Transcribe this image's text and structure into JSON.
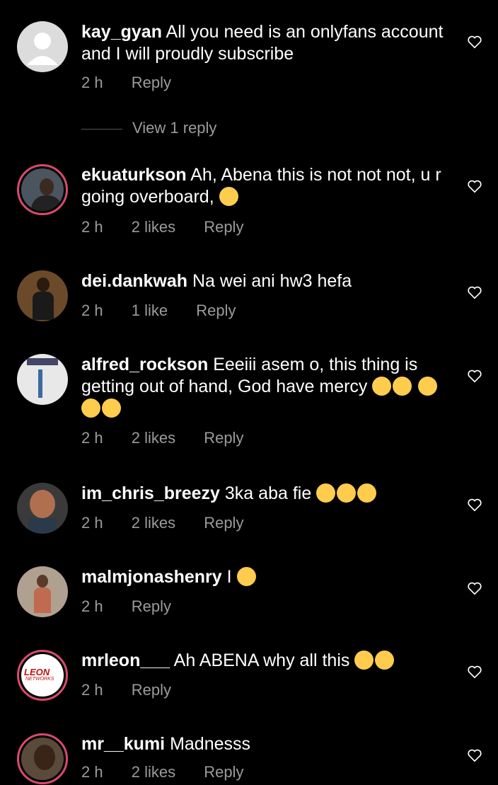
{
  "comments": [
    {
      "username": "kay_gyan",
      "text": "All you need is an onlyfans account and I will proudly subscribe",
      "time": "2 h",
      "likes": "",
      "reply": "Reply"
    },
    {
      "username": "ekuaturkson",
      "text": "Ah, Abena this is not not not, u r going overboard,",
      "time": "2 h",
      "likes": "2 likes",
      "reply": "Reply"
    },
    {
      "username": "dei.dankwah",
      "text": "Na wei ani hw3 hefa",
      "time": "2 h",
      "likes": "1 like",
      "reply": "Reply"
    },
    {
      "username": "alfred_rockson",
      "text": "Eeeiii asem o, this thing is getting out of hand, God have mercy",
      "time": "2 h",
      "likes": "2 likes",
      "reply": "Reply"
    },
    {
      "username": "im_chris_breezy",
      "text": "3ka aba fie",
      "time": "2 h",
      "likes": "2 likes",
      "reply": "Reply"
    },
    {
      "username": "malmjonashenry",
      "text": "I",
      "time": "2 h",
      "likes": "",
      "reply": "Reply"
    },
    {
      "username": "mrleon___",
      "text": "Ah ABENA why all this",
      "time": "2 h",
      "likes": "",
      "reply": "Reply"
    },
    {
      "username": "mr__kumi",
      "text": "Madnesss",
      "time": "2 h",
      "likes": "2 likes",
      "reply": "Reply"
    }
  ],
  "view_replies": "View 1 reply",
  "avatar_text": {
    "mrleon_logo_1": "LEON",
    "mrleon_logo_2": "NETWORKS"
  },
  "colors": {
    "background": "#000000",
    "meta_text": "#9b9b9b",
    "ring": "#d94a6e",
    "emoji": "#ffcc4d"
  },
  "icons": {
    "like": "heart-outline-icon",
    "emoji_sad": "crying-face",
    "emoji_wow": "astonished-face",
    "emoji_laugh": "laughing-face"
  }
}
